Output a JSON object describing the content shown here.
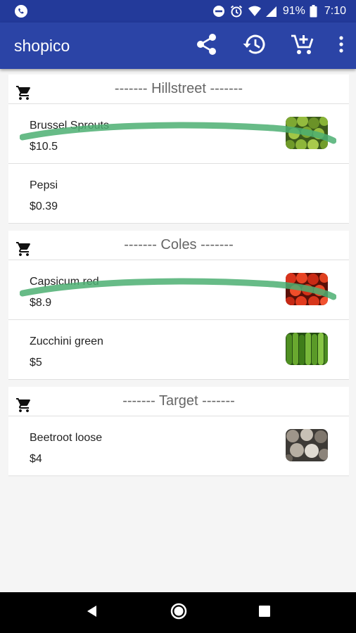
{
  "status": {
    "battery_pct": "91%",
    "time": "7:10"
  },
  "app": {
    "title": "shopico"
  },
  "icons": {
    "share": "share-icon",
    "history": "history-icon",
    "add_cart": "add-shopping-cart-icon",
    "overflow": "more-vert-icon"
  },
  "colors": {
    "app_bar": "#2b44a6",
    "status_bar": "#233a9a",
    "strike": "#4caf72"
  },
  "stores": [
    {
      "name": "------- Hillstreet -------",
      "items": [
        {
          "name": "Brussel Sprouts",
          "price": "$10.5",
          "struck": true,
          "thumb": "brussel-sprouts"
        },
        {
          "name": "Pepsi",
          "price": "$0.39",
          "struck": false,
          "thumb": null
        }
      ]
    },
    {
      "name": "------- Coles -------",
      "items": [
        {
          "name": "Capsicum red",
          "price": "$8.9",
          "struck": true,
          "thumb": "red-capsicum"
        },
        {
          "name": "Zucchini green",
          "price": "$5",
          "struck": false,
          "thumb": "zucchini"
        }
      ]
    },
    {
      "name": "------- Target -------",
      "items": [
        {
          "name": "Beetroot loose",
          "price": "$4",
          "struck": false,
          "thumb": "beetroot"
        }
      ]
    }
  ]
}
